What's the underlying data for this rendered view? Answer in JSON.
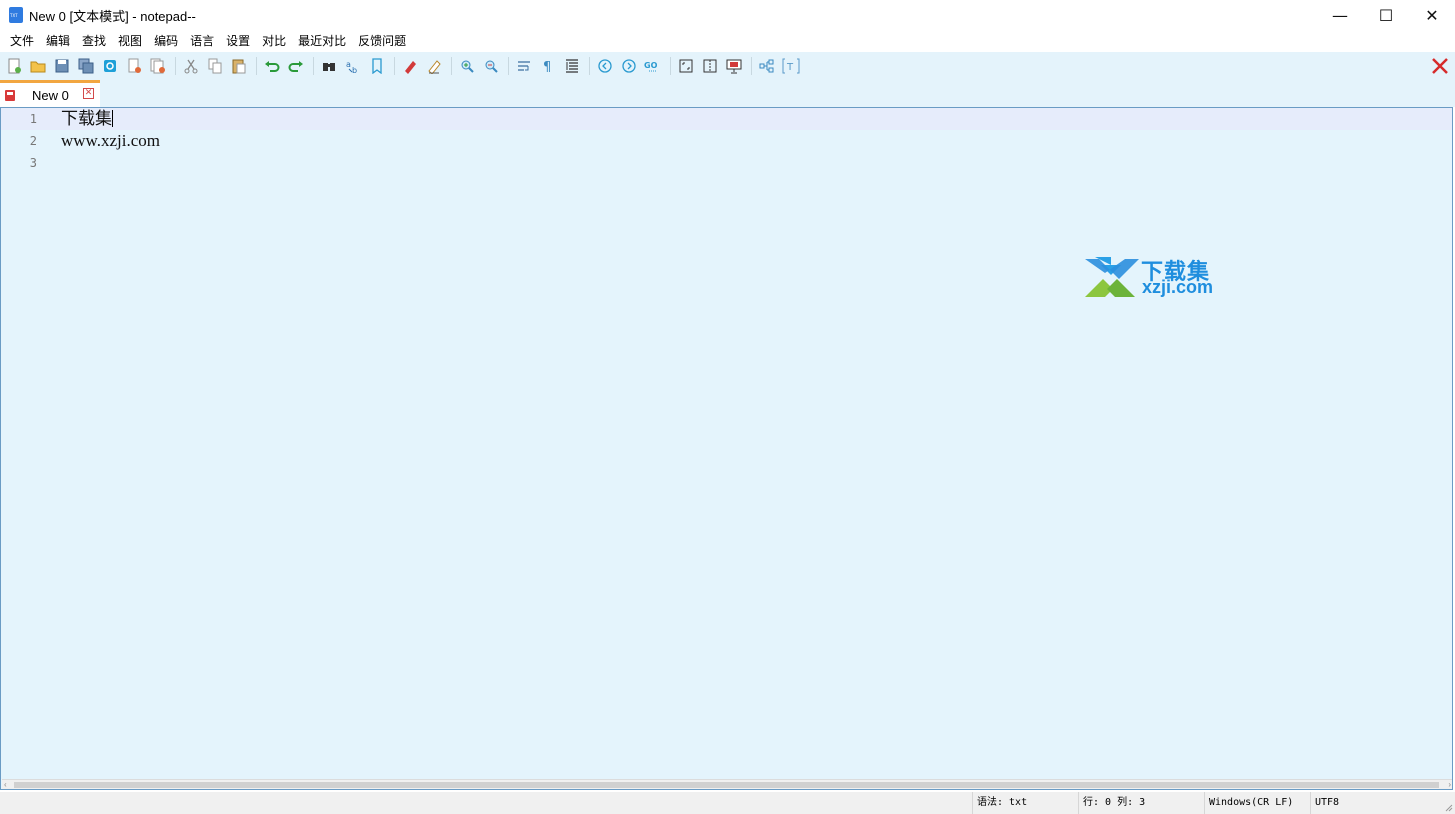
{
  "window": {
    "title": "New 0 [文本模式] - notepad--",
    "minimize": "—",
    "maximize": "☐",
    "close": "✕"
  },
  "menu": [
    "文件",
    "编辑",
    "查找",
    "视图",
    "编码",
    "语言",
    "设置",
    "对比",
    "最近对比",
    "反馈问题"
  ],
  "tabs": [
    {
      "label": "New 0",
      "active": true
    }
  ],
  "editor": {
    "lines": [
      {
        "number": "1",
        "text": "下载集"
      },
      {
        "number": "2",
        "text": "www.xzji.com"
      },
      {
        "number": "3",
        "text": ""
      }
    ],
    "watermark": {
      "line1": "下载集",
      "line2": "xzji.com"
    }
  },
  "statusbar": {
    "syntax": "语法: txt",
    "position": "行: 0 列: 3",
    "eol": "Windows(CR LF)",
    "encoding": "UTF8"
  },
  "colors": {
    "editor_bg": "#e4f4fc",
    "current_line_bg": "#e6ecfb",
    "tab_accent": "#f2a640",
    "close_red": "#d24a4a",
    "brand_blue": "#1f8ede",
    "brand_green": "#7cc242"
  }
}
